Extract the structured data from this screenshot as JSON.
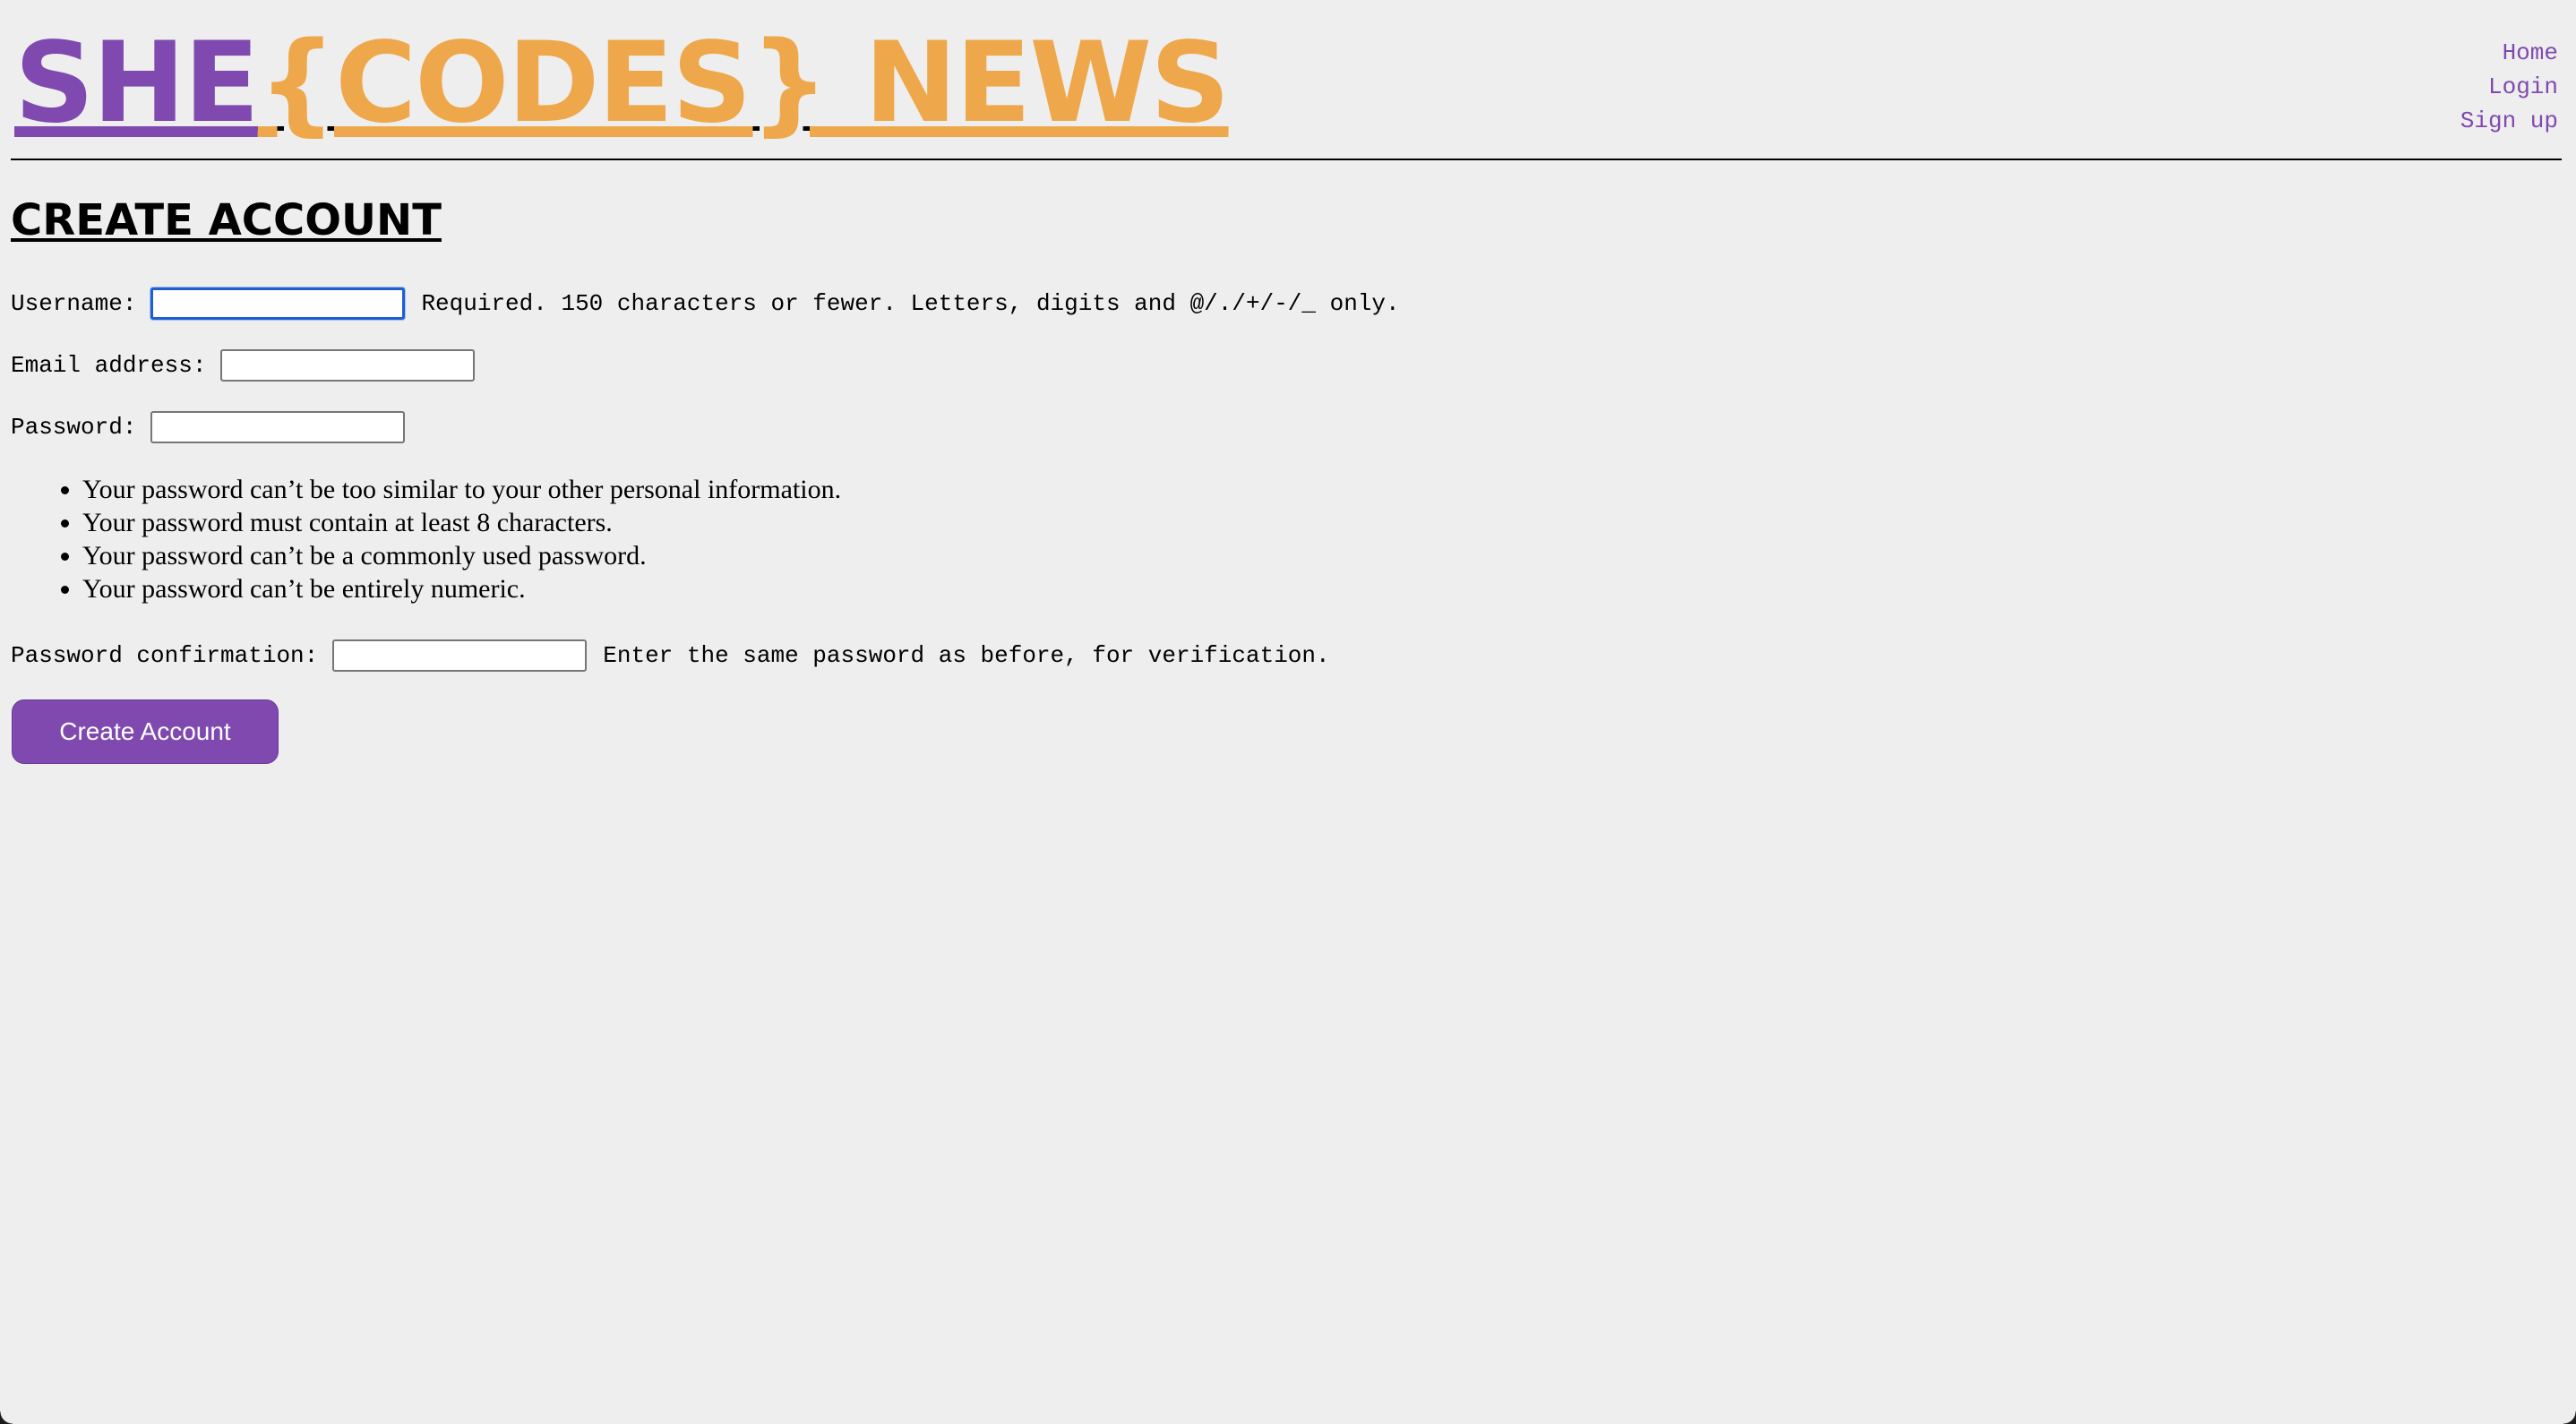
{
  "header": {
    "logo_part1": "SHE",
    "logo_part2": "{CODES} NEWS",
    "nav": {
      "home": "Home",
      "login": "Login",
      "signup": "Sign up"
    }
  },
  "main": {
    "title": "CREATE ACCOUNT",
    "form": {
      "username_label": "Username:",
      "username_value": "",
      "username_help": "Required. 150 characters or fewer. Letters, digits and @/./+/-/_ only.",
      "email_label": "Email address:",
      "email_value": "",
      "password_label": "Password:",
      "password_value": "",
      "password_rules": [
        "Your password can’t be too similar to your other personal information.",
        "Your password must contain at least 8 characters.",
        "Your password can’t be a commonly used password.",
        "Your password can’t be entirely numeric."
      ],
      "confirm_label": "Password confirmation:",
      "confirm_value": "",
      "confirm_help": "Enter the same password as before, for verification.",
      "submit_label": "Create Account"
    }
  },
  "colors": {
    "purple": "#7f49b0",
    "orange": "#eea84b",
    "background": "#eeeeee",
    "focus_ring": "#1f5fcf"
  }
}
